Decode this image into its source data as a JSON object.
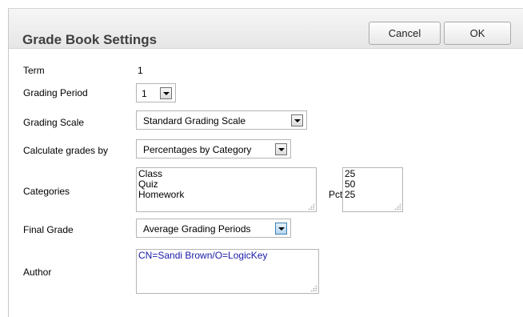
{
  "header": {
    "title": "Grade Book Settings",
    "cancel_label": "Cancel",
    "ok_label": "OK"
  },
  "term": {
    "label": "Term",
    "value": "1"
  },
  "grading_period": {
    "label": "Grading Period",
    "value": "1"
  },
  "grading_scale": {
    "label": "Grading Scale",
    "value": "Standard Grading Scale"
  },
  "calculate": {
    "label": "Calculate grades by",
    "value": "Percentages by Category"
  },
  "categories": {
    "label": "Categories",
    "items": [
      "Class",
      "Quiz",
      "Homework"
    ],
    "pct_label": "Pct",
    "pcts": [
      "25",
      "50",
      "25"
    ]
  },
  "final_grade": {
    "label": "Final Grade",
    "value": "Average Grading Periods"
  },
  "author": {
    "label": "Author",
    "value": "CN=Sandi Brown/O=LogicKey"
  },
  "icons": {
    "dropdown": "chevron-down-icon",
    "resize": "resize-grip-icon"
  }
}
